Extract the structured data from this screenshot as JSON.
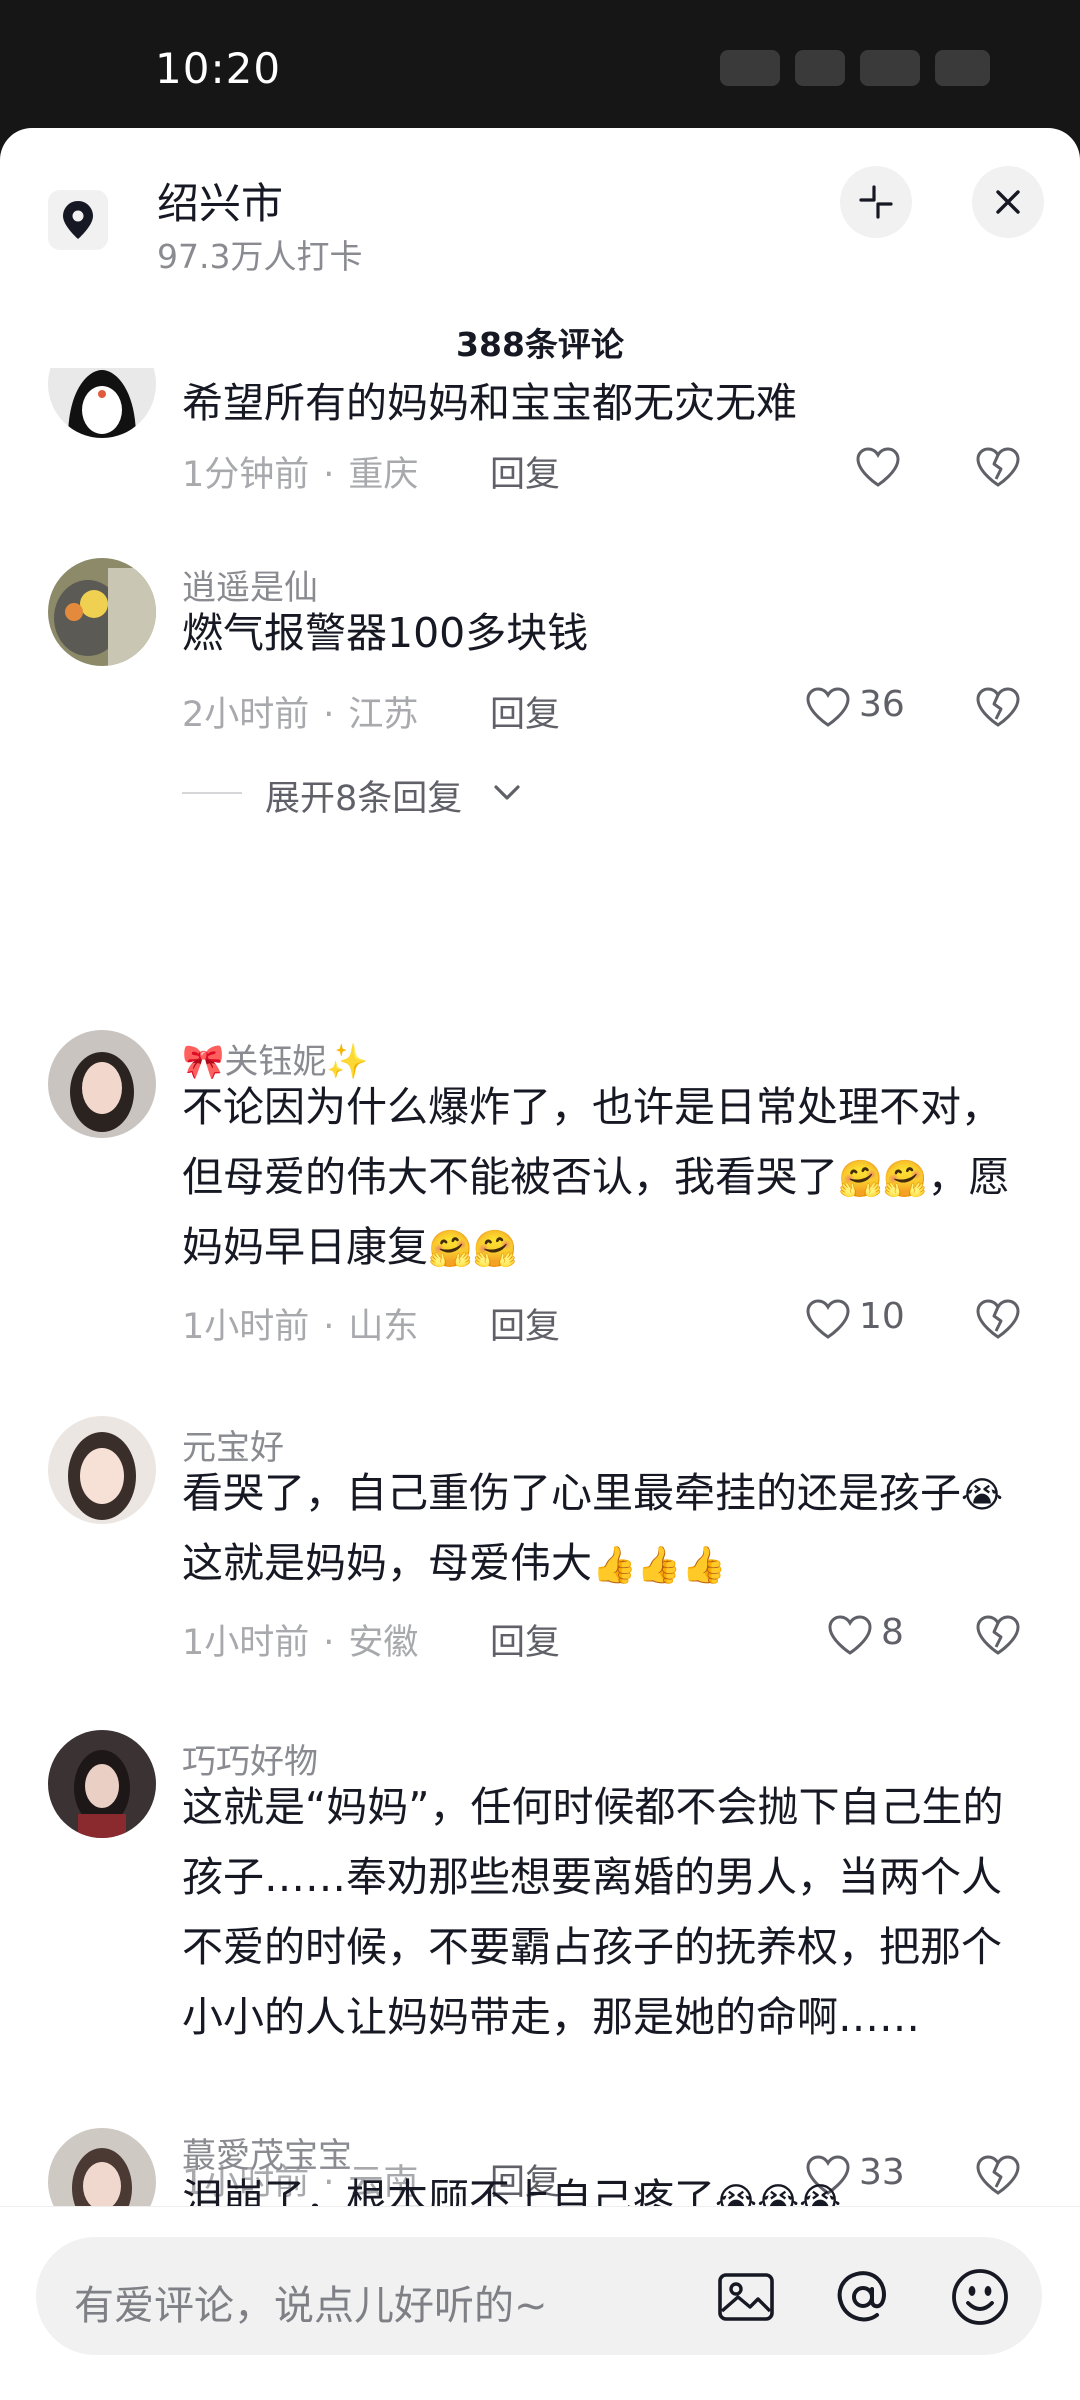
{
  "status_bar": {
    "time": "10:20"
  },
  "location": {
    "name": "绍兴市",
    "checkins": "97.3万人打卡"
  },
  "comments_header": {
    "count_label": "388条评论"
  },
  "comments": [
    {
      "name": "",
      "text": "希望所有的妈妈和宝宝都无灾无难",
      "time": "1分钟前",
      "region": "重庆",
      "reply": "回复",
      "likes": ""
    },
    {
      "name": "逍遥是仙",
      "text": "燃气报警器100多块钱",
      "time": "2小时前",
      "region": "江苏",
      "reply": "回复",
      "likes": "36",
      "expand": "展开8条回复"
    },
    {
      "name": "🎀关钰妮✨",
      "text_parts": [
        "不论因为什么爆炸了，也许是日常处理不对，但母爱的伟大不能被否认，我看哭了",
        "🤗🤗",
        "，愿妈妈早日康复",
        "🤗🤗"
      ],
      "time": "1小时前",
      "region": "山东",
      "reply": "回复",
      "likes": "10"
    },
    {
      "name": "元宝好",
      "text_parts": [
        "看哭了，自己重伤了心里最牵挂的还是孩子",
        "😭",
        "这就是妈妈，母爱伟大",
        "👍👍👍"
      ],
      "time": "1小时前",
      "region": "安徽",
      "reply": "回复",
      "likes": "8"
    },
    {
      "name": "巧巧好物",
      "text": "这就是“妈妈”，任何时候都不会抛下自己生的孩子……奉劝那些想要离婚的男人，当两个人不爱的时候，不要霸占孩子的抚养权，把那个小小的人让妈妈带走，那是她的命啊……",
      "time": "1小时前",
      "region": "云南",
      "reply": "回复",
      "likes": "33"
    },
    {
      "name": "蕞愛茂宝宝",
      "text_parts": [
        "泪崩了，根本顾不上自己疼了",
        "😭😭😭"
      ]
    }
  ],
  "input": {
    "placeholder": "有爱评论，说点儿好听的~"
  },
  "icons": [
    "location-pin-icon",
    "collapse-icon",
    "close-icon",
    "heart-icon",
    "dislike-heart-icon",
    "chevron-down-icon",
    "image-icon",
    "at-icon",
    "emoji-icon"
  ]
}
